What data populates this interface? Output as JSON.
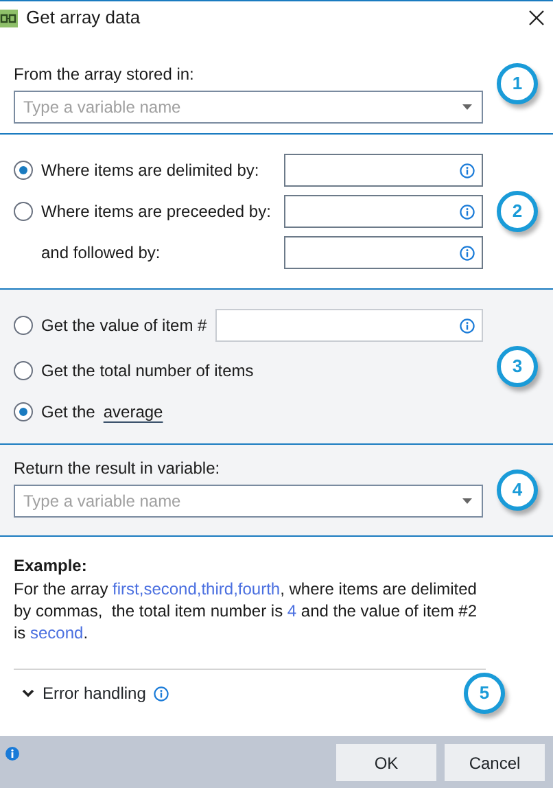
{
  "window": {
    "title": "Get array data"
  },
  "source": {
    "step": "1",
    "label": "From the array stored in:",
    "placeholder": "Type a variable name"
  },
  "delimiters": {
    "step": "2",
    "options": [
      {
        "label": "Where items are delimited by:",
        "selected": true
      },
      {
        "label": "Where items are preceeded by:",
        "selected": false
      }
    ],
    "followed_label": "and followed by:"
  },
  "operations": {
    "step": "3",
    "options": [
      {
        "kind": "field",
        "label": "Get the value of item #",
        "selected": false
      },
      {
        "kind": "plain",
        "label": "Get the total number of items",
        "selected": false
      },
      {
        "kind": "link",
        "label": "Get the",
        "link": "average",
        "selected": true
      }
    ]
  },
  "result": {
    "step": "4",
    "label": "Return the result in variable:",
    "placeholder": "Type a variable name"
  },
  "example": {
    "heading": "Example:",
    "segments": [
      {
        "text": "For the array ",
        "highlight": false
      },
      {
        "text": "first,second,third,fourth",
        "highlight": true
      },
      {
        "text": ", where items are delimited by commas,  the total item number is ",
        "highlight": false
      },
      {
        "text": "4",
        "highlight": true
      },
      {
        "text": " and the value of item #2 is ",
        "highlight": false
      },
      {
        "text": "second",
        "highlight": true
      },
      {
        "text": ".",
        "highlight": false
      }
    ]
  },
  "error_handling": {
    "step": "5",
    "label": "Error handling",
    "expanded": false
  },
  "buttons": [
    "OK",
    "Cancel"
  ]
}
